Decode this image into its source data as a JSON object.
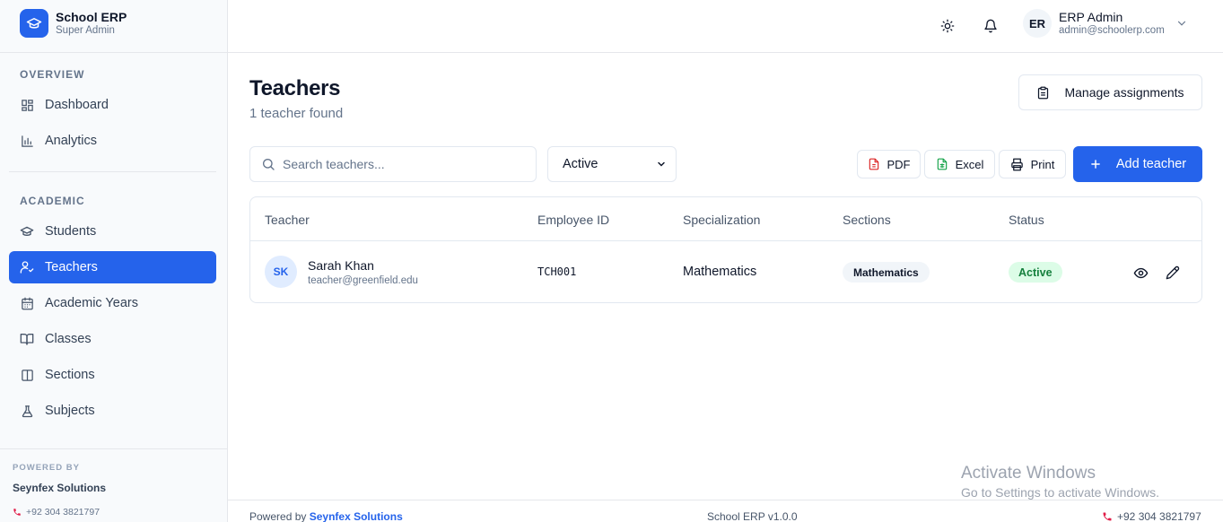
{
  "brand": {
    "title": "School ERP",
    "subtitle": "Super Admin"
  },
  "sidebar": {
    "overview_label": "OVERVIEW",
    "academic_label": "ACADEMIC",
    "items": [
      {
        "label": "Dashboard",
        "icon": "dashboard-icon"
      },
      {
        "label": "Analytics",
        "icon": "bar-chart-icon"
      },
      {
        "label": "Students",
        "icon": "graduation-cap-icon"
      },
      {
        "label": "Teachers",
        "icon": "user-check-icon",
        "active": true
      },
      {
        "label": "Academic Years",
        "icon": "calendar-icon"
      },
      {
        "label": "Classes",
        "icon": "book-open-icon"
      },
      {
        "label": "Sections",
        "icon": "columns-icon"
      },
      {
        "label": "Subjects",
        "icon": "flask-icon"
      }
    ],
    "footer": {
      "powered_label": "POWERED BY",
      "company": "Seynfex Solutions",
      "phone": "+92 304 3821797"
    }
  },
  "topbar": {
    "user_initials": "ER",
    "user_name": "ERP Admin",
    "user_email": "admin@schoolerp.com"
  },
  "page": {
    "title": "Teachers",
    "subtitle": "1 teacher found",
    "manage_label": "Manage assignments"
  },
  "toolbar": {
    "search_placeholder": "Search teachers...",
    "status_filter": "Active",
    "pdf_label": "PDF",
    "excel_label": "Excel",
    "print_label": "Print",
    "add_label": "Add teacher"
  },
  "table": {
    "headers": [
      "Teacher",
      "Employee ID",
      "Specialization",
      "Sections",
      "Status"
    ],
    "rows": [
      {
        "initials": "SK",
        "name": "Sarah Khan",
        "email": "teacher@greenfield.edu",
        "employee_id": "TCH001",
        "specialization": "Mathematics",
        "section": "Mathematics",
        "status": "Active"
      }
    ]
  },
  "footer": {
    "powered_prefix": "Powered by",
    "company": "Seynfex Solutions",
    "version": "School ERP v1.0.0",
    "phone": "+92 304 3821797"
  },
  "watermark": {
    "line1": "Activate Windows",
    "line2": "Go to Settings to activate Windows."
  },
  "colors": {
    "accent": "#2563eb",
    "status_active_bg": "#dcfce7",
    "status_active_text": "#15803d"
  }
}
